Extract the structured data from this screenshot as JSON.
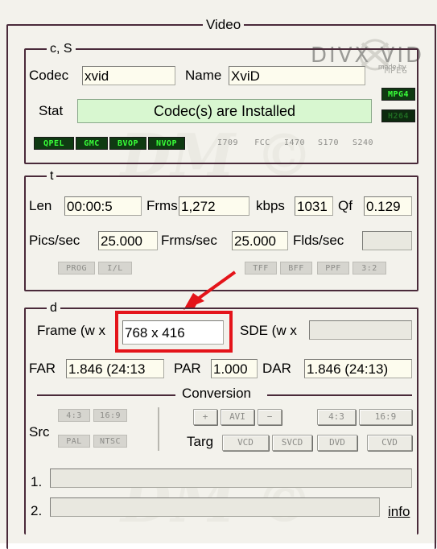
{
  "video": {
    "legend": "Video",
    "logo": {
      "brand": "DIVX VID",
      "sub": "made by"
    }
  },
  "codec_section": {
    "legend": "c, S",
    "codec_label": "Codec",
    "codec_value": "xvid",
    "name_label": "Name",
    "name_value": "XviD",
    "stat_label": "Stat",
    "stat_value": "Codec(s) are Installed",
    "format_tags": [
      {
        "label": "MPEG",
        "active": false
      },
      {
        "label": "MPG4",
        "active": true
      },
      {
        "label": "H264",
        "active": true
      }
    ],
    "feature_tags": [
      {
        "label": "QPEL",
        "active": true
      },
      {
        "label": "GMC",
        "active": true
      },
      {
        "label": "BVOP",
        "active": true
      },
      {
        "label": "NVOP",
        "active": true
      },
      {
        "label": "I709",
        "active": false
      },
      {
        "label": "FCC",
        "active": false
      },
      {
        "label": "I470",
        "active": false
      },
      {
        "label": "S170",
        "active": false
      },
      {
        "label": "S240",
        "active": false
      }
    ]
  },
  "time_section": {
    "legend": "t",
    "len_label": "Len",
    "len_value": "00:00:5",
    "frms_label": "Frms",
    "frms_value": "1,272",
    "kbps_label": "kbps",
    "kbps_value": "1031",
    "qf_label": "Qf",
    "qf_value": "0.129",
    "pics_label": "Pics/sec",
    "pics_value": "25.000",
    "frmssec_label": "Frms/sec",
    "frmssec_value": "25.000",
    "flds_label": "Flds/sec",
    "flds_value": "",
    "scan_tags": [
      "PROG",
      "I/L"
    ],
    "field_tags": [
      "TFF",
      "BFF",
      "PPF",
      "3:2"
    ]
  },
  "dimension_section": {
    "legend": "d",
    "frame_label": "Frame (w x",
    "frame_value": "768 x 416",
    "sde_label": "SDE (w x",
    "sde_value": "",
    "far_label": "FAR",
    "far_value": "1.846 (24:13",
    "par_label": "PAR",
    "par_value": "1.000",
    "dar_label": "DAR",
    "dar_value": "1.846 (24:13)",
    "conversion_label": "Conversion",
    "src_label": "Src",
    "src_buttons": [
      "4:3",
      "16:9",
      "PAL",
      "NTSC"
    ],
    "targ_label": "Targ",
    "targ_row1": [
      "+",
      "AVI",
      "−",
      "4:3",
      "16:9"
    ],
    "targ_row2": [
      "VCD",
      "SVCD",
      "DVD",
      "CVD"
    ],
    "line1_label": "1.",
    "line2_label": "2.",
    "info_label": "info"
  },
  "colors": {
    "frame_border": "#4a2a3a",
    "highlight": "#e4141a",
    "active_tag_bg": "#0f3a12",
    "active_tag_fg": "#39ff39",
    "stat_bg": "#d8f7d0"
  }
}
